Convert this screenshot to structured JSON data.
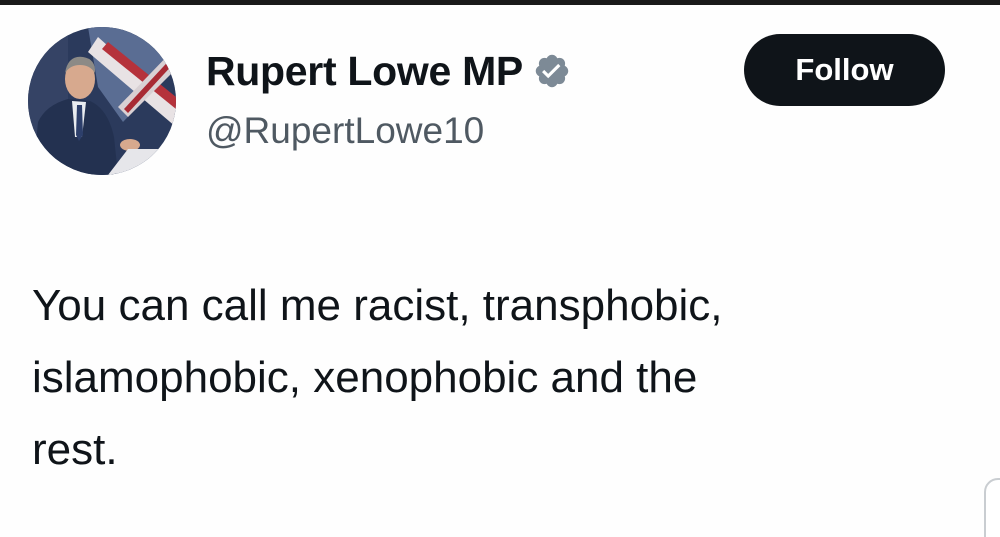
{
  "profile": {
    "display_name": "Rupert Lowe MP",
    "handle": "@RupertLowe10",
    "verified": true,
    "verified_icon": "verified-badge-icon",
    "verified_color": "#7d8a96"
  },
  "actions": {
    "follow_label": "Follow"
  },
  "tweet": {
    "lines": [
      "You can call me racist, transphobic,",
      "islamophobic, xenophobic and the",
      "rest."
    ]
  },
  "colors": {
    "text_primary": "#0f1419",
    "text_secondary": "#4f5962",
    "button_bg": "#0f1419",
    "button_text": "#ffffff"
  }
}
